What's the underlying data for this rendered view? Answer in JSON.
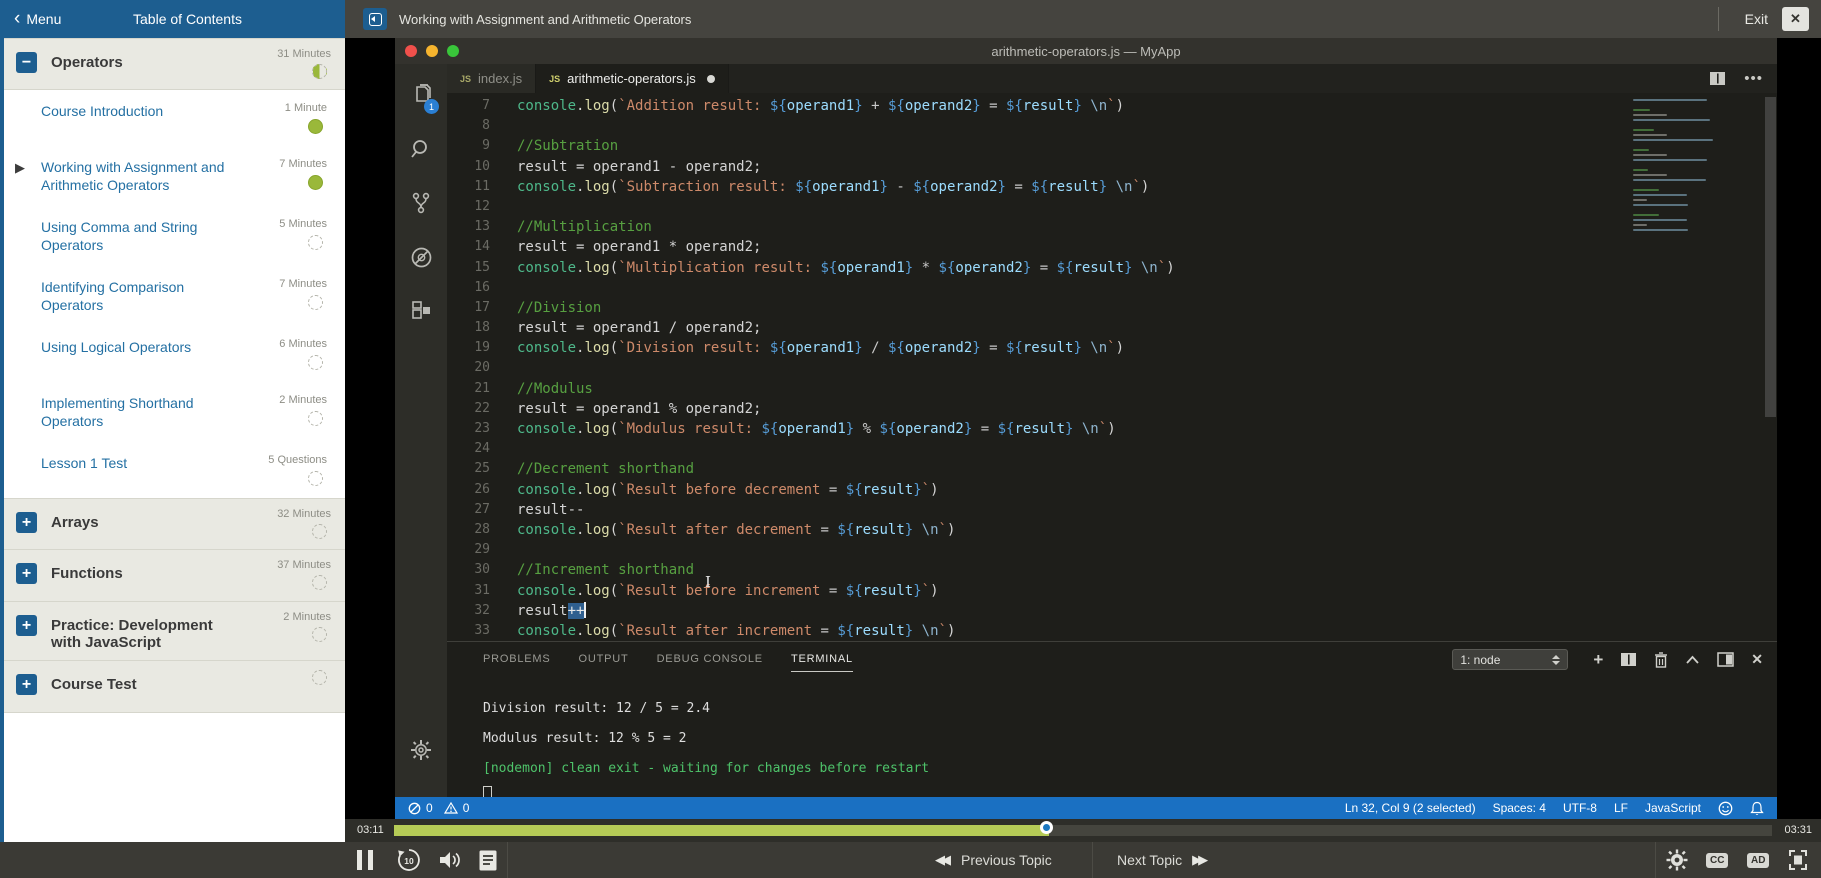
{
  "header": {
    "menu": {
      "chevron": "‹",
      "label": "Menu"
    },
    "toc_title": "Table of Contents",
    "lesson_title": "Working with Assignment and Arithmetic Operators",
    "exit_label": "Exit",
    "close_label": "✕"
  },
  "sidebar": {
    "sections": [
      {
        "label": "Operators",
        "duration": "31 Minutes",
        "toggle": "−",
        "expanded": true,
        "progress": "half",
        "items": [
          {
            "label": "Course Introduction",
            "duration": "1 Minute",
            "status": "complete",
            "current": false
          },
          {
            "label": "Working with Assignment and Arithmetic Operators",
            "duration": "7 Minutes",
            "status": "complete",
            "current": true
          },
          {
            "label": "Using Comma and String Operators",
            "duration": "5 Minutes",
            "status": "todo",
            "current": false
          },
          {
            "label": "Identifying Comparison Operators",
            "duration": "7 Minutes",
            "status": "todo",
            "current": false
          },
          {
            "label": "Using Logical Operators",
            "duration": "6 Minutes",
            "status": "todo",
            "current": false
          },
          {
            "label": "Implementing Shorthand Operators",
            "duration": "2 Minutes",
            "status": "todo",
            "current": false
          },
          {
            "label": "Lesson 1 Test",
            "duration": "5 Questions",
            "status": "todo",
            "current": false
          }
        ]
      },
      {
        "label": "Arrays",
        "duration": "32 Minutes",
        "toggle": "+",
        "expanded": false,
        "progress": "todo",
        "items": []
      },
      {
        "label": "Functions",
        "duration": "37 Minutes",
        "toggle": "+",
        "expanded": false,
        "progress": "todo",
        "items": []
      },
      {
        "label": "Practice: Development with JavaScript",
        "duration": "2 Minutes",
        "toggle": "+",
        "expanded": false,
        "progress": "todo",
        "items": []
      },
      {
        "label": "Course Test",
        "duration": "",
        "toggle": "+",
        "expanded": false,
        "progress": "todo",
        "items": []
      }
    ]
  },
  "vscode": {
    "window_title": "arithmetic-operators.js — MyApp",
    "activity_badge": "1",
    "tabs": [
      {
        "icon": "JS",
        "label": "index.js",
        "active": false,
        "dirty": false
      },
      {
        "icon": "JS",
        "label": "arithmetic-operators.js",
        "active": true,
        "dirty": true
      }
    ],
    "panel": {
      "tabs": [
        "PROBLEMS",
        "OUTPUT",
        "DEBUG CONSOLE",
        "TERMINAL"
      ],
      "active_tab": "TERMINAL",
      "shell_selector": "1: node",
      "terminal_lines": [
        {
          "color": "plain",
          "text": "Division result: 12 / 5 = 2.4"
        },
        {
          "color": "plain",
          "text": "Modulus result: 12 % 5 = 2"
        },
        {
          "color": "green",
          "text": "[nodemon] clean exit - waiting for changes before restart"
        }
      ]
    },
    "status_bar": {
      "errors": "0",
      "warnings": "0",
      "right_items": [
        "Ln 32, Col 9 (2 selected)",
        "Spaces: 4",
        "UTF-8",
        "LF",
        "JavaScript"
      ]
    }
  },
  "code": {
    "lines": [
      {
        "n": 7,
        "seg": [
          [
            "f",
            "console"
          ],
          [
            "w",
            "."
          ],
          [
            "m",
            "log"
          ],
          [
            "w",
            "("
          ],
          [
            "s",
            "`Addition result: "
          ],
          [
            "t",
            "${"
          ],
          [
            "v",
            "operand1"
          ],
          [
            "t",
            "}"
          ],
          [
            "s",
            " "
          ],
          [
            "o",
            "+"
          ],
          [
            "s",
            " "
          ],
          [
            "t",
            "${"
          ],
          [
            "v",
            "operand2"
          ],
          [
            "t",
            "}"
          ],
          [
            "s",
            " "
          ],
          [
            "o",
            "="
          ],
          [
            "s",
            " "
          ],
          [
            "t",
            "${"
          ],
          [
            "v",
            "result"
          ],
          [
            "t",
            "}"
          ],
          [
            "e",
            " \\n"
          ],
          [
            "s",
            "`"
          ],
          [
            "w",
            ")"
          ]
        ]
      },
      {
        "n": 8,
        "seg": []
      },
      {
        "n": 9,
        "seg": [
          [
            "c",
            "//Subtration"
          ]
        ]
      },
      {
        "n": 10,
        "seg": [
          [
            "w",
            "result = operand1 - operand2;"
          ]
        ]
      },
      {
        "n": 11,
        "seg": [
          [
            "f",
            "console"
          ],
          [
            "w",
            "."
          ],
          [
            "m",
            "log"
          ],
          [
            "w",
            "("
          ],
          [
            "s",
            "`Subtraction result: "
          ],
          [
            "t",
            "${"
          ],
          [
            "v",
            "operand1"
          ],
          [
            "t",
            "}"
          ],
          [
            "s",
            " "
          ],
          [
            "o",
            "-"
          ],
          [
            "s",
            " "
          ],
          [
            "t",
            "${"
          ],
          [
            "v",
            "operand2"
          ],
          [
            "t",
            "}"
          ],
          [
            "s",
            " "
          ],
          [
            "o",
            "="
          ],
          [
            "s",
            " "
          ],
          [
            "t",
            "${"
          ],
          [
            "v",
            "result"
          ],
          [
            "t",
            "}"
          ],
          [
            "e",
            " \\n"
          ],
          [
            "s",
            "`"
          ],
          [
            "w",
            ")"
          ]
        ]
      },
      {
        "n": 12,
        "seg": []
      },
      {
        "n": 13,
        "seg": [
          [
            "c",
            "//Multiplication"
          ]
        ]
      },
      {
        "n": 14,
        "seg": [
          [
            "w",
            "result = operand1 * operand2;"
          ]
        ]
      },
      {
        "n": 15,
        "seg": [
          [
            "f",
            "console"
          ],
          [
            "w",
            "."
          ],
          [
            "m",
            "log"
          ],
          [
            "w",
            "("
          ],
          [
            "s",
            "`Multiplication result: "
          ],
          [
            "t",
            "${"
          ],
          [
            "v",
            "operand1"
          ],
          [
            "t",
            "}"
          ],
          [
            "s",
            " "
          ],
          [
            "o",
            "*"
          ],
          [
            "s",
            " "
          ],
          [
            "t",
            "${"
          ],
          [
            "v",
            "operand2"
          ],
          [
            "t",
            "}"
          ],
          [
            "s",
            " "
          ],
          [
            "o",
            "="
          ],
          [
            "s",
            " "
          ],
          [
            "t",
            "${"
          ],
          [
            "v",
            "result"
          ],
          [
            "t",
            "}"
          ],
          [
            "e",
            " \\n"
          ],
          [
            "s",
            "`"
          ],
          [
            "w",
            ")"
          ]
        ]
      },
      {
        "n": 16,
        "seg": []
      },
      {
        "n": 17,
        "seg": [
          [
            "c",
            "//Division"
          ]
        ]
      },
      {
        "n": 18,
        "seg": [
          [
            "w",
            "result = operand1 / operand2;"
          ]
        ]
      },
      {
        "n": 19,
        "seg": [
          [
            "f",
            "console"
          ],
          [
            "w",
            "."
          ],
          [
            "m",
            "log"
          ],
          [
            "w",
            "("
          ],
          [
            "s",
            "`Division result: "
          ],
          [
            "t",
            "${"
          ],
          [
            "v",
            "operand1"
          ],
          [
            "t",
            "}"
          ],
          [
            "s",
            " "
          ],
          [
            "o",
            "/"
          ],
          [
            "s",
            " "
          ],
          [
            "t",
            "${"
          ],
          [
            "v",
            "operand2"
          ],
          [
            "t",
            "}"
          ],
          [
            "s",
            " "
          ],
          [
            "o",
            "="
          ],
          [
            "s",
            " "
          ],
          [
            "t",
            "${"
          ],
          [
            "v",
            "result"
          ],
          [
            "t",
            "}"
          ],
          [
            "e",
            " \\n"
          ],
          [
            "s",
            "`"
          ],
          [
            "w",
            ")"
          ]
        ]
      },
      {
        "n": 20,
        "seg": []
      },
      {
        "n": 21,
        "seg": [
          [
            "c",
            "//Modulus"
          ]
        ]
      },
      {
        "n": 22,
        "seg": [
          [
            "w",
            "result = operand1 % operand2;"
          ]
        ]
      },
      {
        "n": 23,
        "seg": [
          [
            "f",
            "console"
          ],
          [
            "w",
            "."
          ],
          [
            "m",
            "log"
          ],
          [
            "w",
            "("
          ],
          [
            "s",
            "`Modulus result: "
          ],
          [
            "t",
            "${"
          ],
          [
            "v",
            "operand1"
          ],
          [
            "t",
            "}"
          ],
          [
            "s",
            " "
          ],
          [
            "o",
            "%"
          ],
          [
            "s",
            " "
          ],
          [
            "t",
            "${"
          ],
          [
            "v",
            "operand2"
          ],
          [
            "t",
            "}"
          ],
          [
            "s",
            " "
          ],
          [
            "o",
            "="
          ],
          [
            "s",
            " "
          ],
          [
            "t",
            "${"
          ],
          [
            "v",
            "result"
          ],
          [
            "t",
            "}"
          ],
          [
            "e",
            " \\n"
          ],
          [
            "s",
            "`"
          ],
          [
            "w",
            ")"
          ]
        ]
      },
      {
        "n": 24,
        "seg": []
      },
      {
        "n": 25,
        "seg": [
          [
            "c",
            "//Decrement shorthand"
          ]
        ]
      },
      {
        "n": 26,
        "seg": [
          [
            "f",
            "console"
          ],
          [
            "w",
            "."
          ],
          [
            "m",
            "log"
          ],
          [
            "w",
            "("
          ],
          [
            "s",
            "`Result before decrement "
          ],
          [
            "o",
            "="
          ],
          [
            "s",
            " "
          ],
          [
            "t",
            "${"
          ],
          [
            "v",
            "result"
          ],
          [
            "t",
            "}"
          ],
          [
            "s",
            "`"
          ],
          [
            "w",
            ")"
          ]
        ]
      },
      {
        "n": 27,
        "seg": [
          [
            "w",
            "result--"
          ]
        ]
      },
      {
        "n": 28,
        "seg": [
          [
            "f",
            "console"
          ],
          [
            "w",
            "."
          ],
          [
            "m",
            "log"
          ],
          [
            "w",
            "("
          ],
          [
            "s",
            "`Result after decrement "
          ],
          [
            "o",
            "="
          ],
          [
            "s",
            " "
          ],
          [
            "t",
            "${"
          ],
          [
            "v",
            "result"
          ],
          [
            "t",
            "}"
          ],
          [
            "e",
            " \\n"
          ],
          [
            "s",
            "`"
          ],
          [
            "w",
            ")"
          ]
        ]
      },
      {
        "n": 29,
        "seg": []
      },
      {
        "n": 30,
        "seg": [
          [
            "c",
            "//Increment shorthand"
          ]
        ]
      },
      {
        "n": 31,
        "seg": [
          [
            "f",
            "console"
          ],
          [
            "w",
            "."
          ],
          [
            "m",
            "log"
          ],
          [
            "w",
            "("
          ],
          [
            "s",
            "`Result before increment "
          ],
          [
            "o",
            "="
          ],
          [
            "s",
            " "
          ],
          [
            "t",
            "${"
          ],
          [
            "v",
            "result"
          ],
          [
            "t",
            "}"
          ],
          [
            "s",
            "`"
          ],
          [
            "w",
            ")"
          ]
        ]
      },
      {
        "n": 32,
        "seg": [
          [
            "w",
            "result"
          ],
          [
            "x",
            "++"
          ]
        ]
      },
      {
        "n": 33,
        "seg": [
          [
            "f",
            "console"
          ],
          [
            "w",
            "."
          ],
          [
            "m",
            "log"
          ],
          [
            "w",
            "("
          ],
          [
            "s",
            "`Result after increment "
          ],
          [
            "o",
            "="
          ],
          [
            "s",
            " "
          ],
          [
            "t",
            "${"
          ],
          [
            "v",
            "result"
          ],
          [
            "t",
            "}"
          ],
          [
            "e",
            " \\n"
          ],
          [
            "s",
            "`"
          ],
          [
            "w",
            ")"
          ]
        ]
      }
    ]
  },
  "player": {
    "elapsed": "03:11",
    "remaining": "03:31",
    "progress_pct": 47.5,
    "previous_label": "Previous Topic",
    "next_label": "Next Topic",
    "cc_label": "CC",
    "ad_label": "AD"
  },
  "colors": {
    "accent_blue": "#1d5e90",
    "status_blue": "#1a70c2",
    "progress_green": "#b5cb56",
    "complete_green": "#9ab83a"
  }
}
